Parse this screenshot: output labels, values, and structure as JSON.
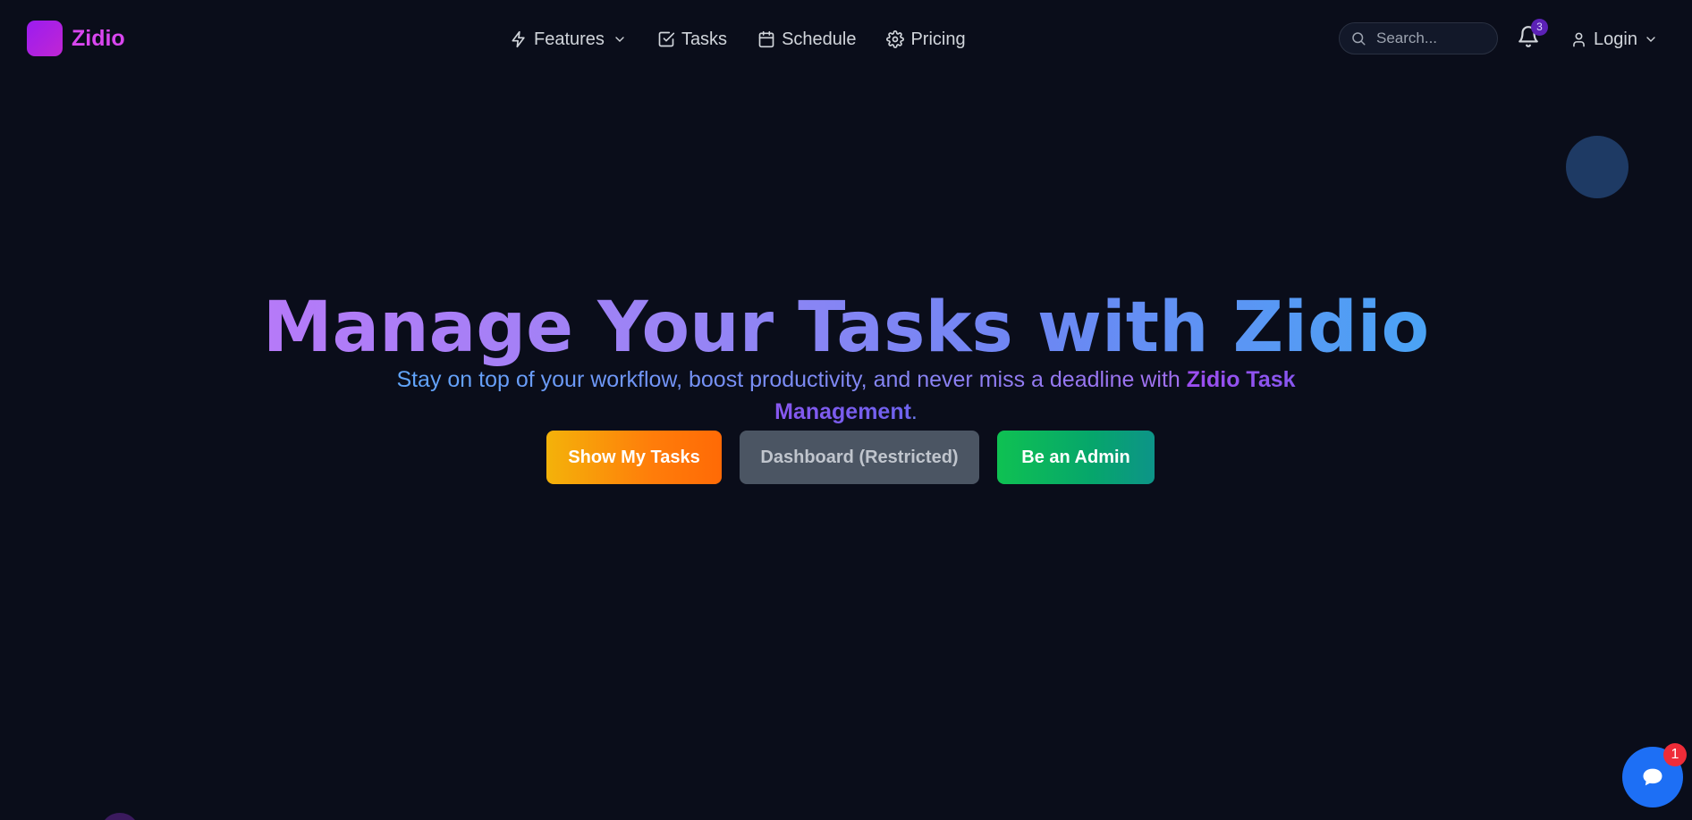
{
  "brand": {
    "name": "Zidio"
  },
  "nav": {
    "items": [
      {
        "label": "Features",
        "icon": "lightning-icon",
        "has_dropdown": true
      },
      {
        "label": "Tasks",
        "icon": "checkbox-icon"
      },
      {
        "label": "Schedule",
        "icon": "calendar-icon"
      },
      {
        "label": "Pricing",
        "icon": "gear-icon"
      }
    ]
  },
  "search": {
    "placeholder": "Search..."
  },
  "notifications": {
    "count": "3"
  },
  "account": {
    "login_label": "Login"
  },
  "hero": {
    "title": "Manage Your Tasks with Zidio",
    "subtitle_prefix": "Stay on top of your workflow, boost productivity, and never miss a deadline with ",
    "subtitle_highlight": "Zidio Task Management",
    "subtitle_suffix": "."
  },
  "buttons": {
    "show_tasks": "Show My Tasks",
    "dashboard": "Dashboard (Restricted)",
    "admin": "Be an Admin"
  },
  "chat": {
    "unread": "1"
  },
  "colors": {
    "background": "#0a0d1a",
    "brand": "#d946ef",
    "tasks_button": "#ff7d0a",
    "dashboard_button": "#4b5563",
    "admin_button": "#0fc152",
    "chat_button": "#1d6ff5",
    "chat_badge": "#ef2c38"
  }
}
